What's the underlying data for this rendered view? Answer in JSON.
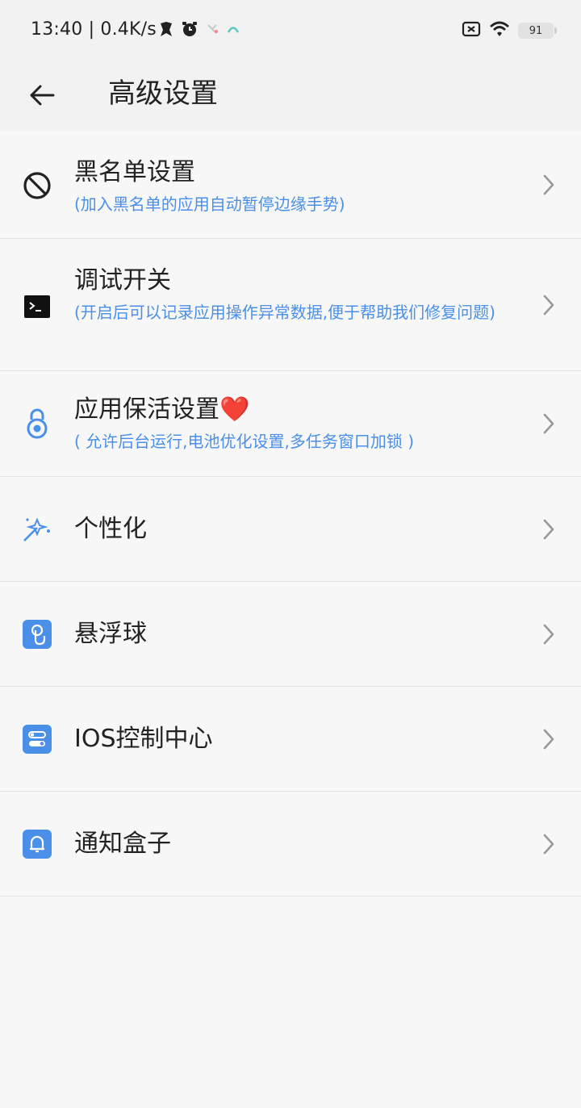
{
  "status_bar": {
    "time_speed": "13:40 | 0.4K/s",
    "battery": "91",
    "icons": [
      "notification-icon",
      "alarm-icon",
      "app-icon",
      "app-icon",
      "sim-icon",
      "wifi-icon",
      "battery-icon"
    ]
  },
  "toolbar": {
    "back_icon": "back-arrow-icon",
    "title": "高级设置"
  },
  "items": [
    {
      "title": "黑名单设置",
      "desc": "(加入黑名单的应用自动暂停边缘手势)",
      "icon": "block-icon"
    },
    {
      "title": "调试开关",
      "desc": "(开启后可以记录应用操作异常数据,便于帮助我们修复问题)",
      "icon": "terminal-icon"
    },
    {
      "title": "应用保活设置",
      "title_suffix": "❤️",
      "desc": "( 允许后台运行,电池优化设置,多任务窗口加锁 )",
      "icon": "lock-icon"
    },
    {
      "title": "个性化",
      "icon": "sparkle-wand-icon"
    },
    {
      "title": "悬浮球",
      "icon": "floating-ball-icon"
    },
    {
      "title": "IOS控制中心",
      "icon": "control-center-icon"
    },
    {
      "title": "通知盒子",
      "icon": "notification-box-icon"
    }
  ],
  "colors": {
    "accent": "#4a8fe8",
    "heart": "#e8323a",
    "background": "#f7f7f7",
    "header": "#f2f2f2"
  }
}
